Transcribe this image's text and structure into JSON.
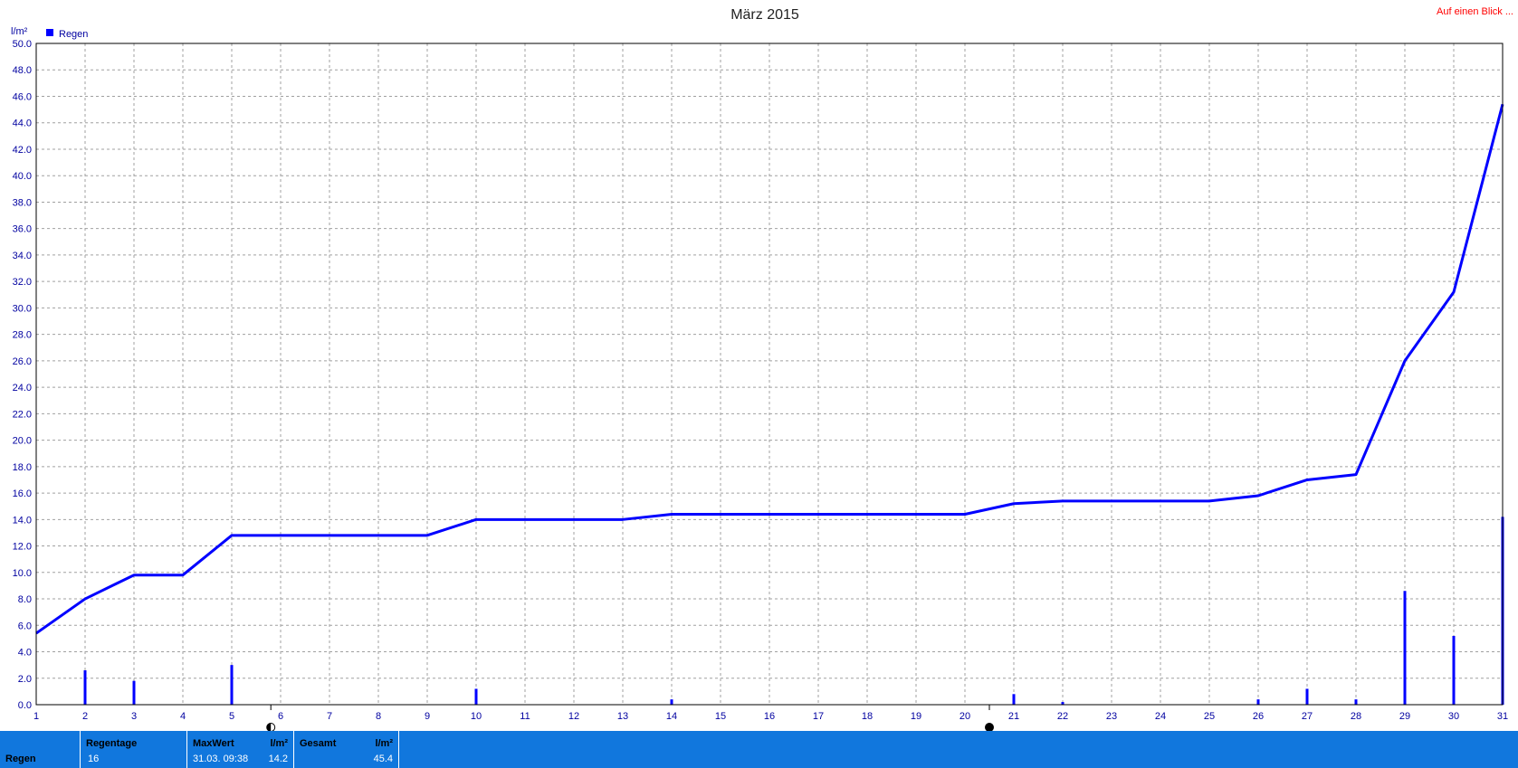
{
  "header": {
    "title": "März 2015",
    "link": "Auf einen Blick ..."
  },
  "legend": {
    "label": "Regen",
    "color": "#0000ff"
  },
  "chart_data": {
    "type": "line",
    "ylabel": "l/m²",
    "ylim": [
      0,
      50
    ],
    "yticks": [
      "0.0",
      "2.0",
      "4.0",
      "6.0",
      "8.0",
      "10.0",
      "12.0",
      "14.0",
      "16.0",
      "18.0",
      "20.0",
      "22.0",
      "24.0",
      "26.0",
      "28.0",
      "30.0",
      "32.0",
      "34.0",
      "36.0",
      "38.0",
      "40.0",
      "42.0",
      "44.0",
      "46.0",
      "48.0",
      "50.0"
    ],
    "xlim": [
      1,
      31
    ],
    "xticks": [
      "1",
      "2",
      "3",
      "4",
      "5",
      "6",
      "7",
      "8",
      "9",
      "10",
      "11",
      "12",
      "13",
      "14",
      "15",
      "16",
      "17",
      "18",
      "19",
      "20",
      "21",
      "22",
      "23",
      "24",
      "25",
      "26",
      "27",
      "28",
      "29",
      "30",
      "31"
    ],
    "grid": true,
    "legend_position": "top-left",
    "series": [
      {
        "name": "Regen",
        "kind": "cumulative-line",
        "color": "#0000ff",
        "x": [
          1,
          2,
          3,
          4,
          5,
          6,
          7,
          8,
          9,
          10,
          11,
          12,
          13,
          14,
          15,
          16,
          17,
          18,
          19,
          20,
          21,
          22,
          23,
          24,
          25,
          26,
          27,
          28,
          29,
          30,
          31
        ],
        "values": [
          5.4,
          8.0,
          9.8,
          9.8,
          12.8,
          12.8,
          12.8,
          12.8,
          12.8,
          14.0,
          14.0,
          14.0,
          14.0,
          14.4,
          14.4,
          14.4,
          14.4,
          14.4,
          14.4,
          14.4,
          15.2,
          15.4,
          15.4,
          15.4,
          15.4,
          15.8,
          17.0,
          17.4,
          26.0,
          31.2,
          45.4
        ]
      },
      {
        "name": "Regen",
        "kind": "daily-bars",
        "color": "#0000ff",
        "x": [
          2,
          3,
          5,
          10,
          14,
          21,
          22,
          26,
          27,
          28,
          29,
          30,
          31
        ],
        "values": [
          2.6,
          1.8,
          3.0,
          1.2,
          0.4,
          0.8,
          0.2,
          0.4,
          1.2,
          0.4,
          8.6,
          5.2,
          14.2
        ]
      }
    ],
    "moon_phases": [
      {
        "day": 5.8,
        "phase": "first-quarter"
      },
      {
        "day": 20.5,
        "phase": "new-moon"
      }
    ]
  },
  "stats": {
    "row_label": "Regen",
    "rain_days_header": "Regentage",
    "rain_days_value": "16",
    "max_header": "MaxWert",
    "max_unit": "l/m²",
    "max_date": "31.03.  09:38",
    "max_value": "14.2",
    "total_header": "Gesamt",
    "total_unit": "l/m²",
    "total_value": "45.4"
  }
}
